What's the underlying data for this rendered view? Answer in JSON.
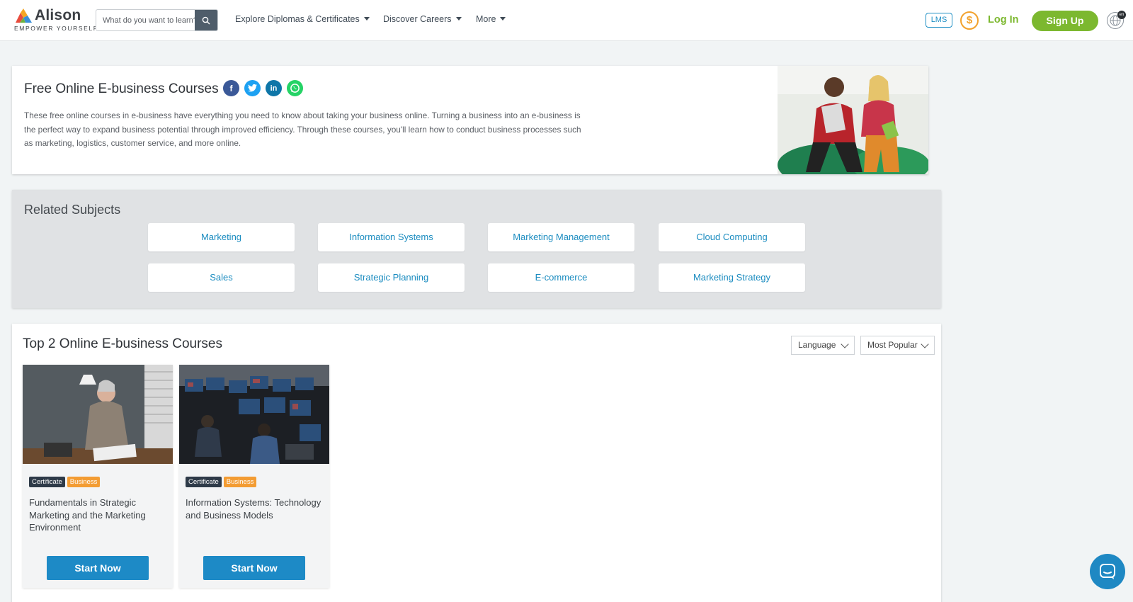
{
  "brand": {
    "name": "Alison",
    "tagline": "EMPOWER YOURSELF"
  },
  "search": {
    "placeholder": "What do you want to learn?"
  },
  "nav": {
    "diplomas": "Explore Diplomas & Certificates",
    "careers": "Discover Careers",
    "more": "More"
  },
  "header_actions": {
    "lms": "LMS",
    "dollar": "$",
    "login": "Log In",
    "signup": "Sign Up",
    "lang_badge": "en"
  },
  "hero": {
    "title": "Free Online E-business Courses",
    "description": "These free online courses in e-business have everything you need to know about taking your business online. Turning a business into an e-business is the perfect way to expand business potential through improved efficiency. Through these courses, you'll learn how to conduct business processes such as marketing, logistics, customer service, and more online.",
    "share_icons": [
      "facebook-icon",
      "twitter-icon",
      "linkedin-icon",
      "whatsapp-icon"
    ]
  },
  "related": {
    "title": "Related Subjects",
    "subjects": [
      "Marketing",
      "Information Systems",
      "Marketing Management",
      "Cloud Computing",
      "Sales",
      "Strategic Planning",
      "E-commerce",
      "Marketing Strategy"
    ]
  },
  "courses": {
    "title": "Top 2 Online E-business Courses",
    "filters": {
      "language": "Language",
      "sort": "Most Popular"
    },
    "items": [
      {
        "type": "Certificate",
        "category": "Business",
        "title": "Fundamentals in Strategic Marketing and the Marketing Environment",
        "cta": "Start Now"
      },
      {
        "type": "Certificate",
        "category": "Business",
        "title": "Information Systems: Technology and Business Models",
        "cta": "Start Now"
      }
    ]
  },
  "colors": {
    "green": "#7cb82f",
    "blue": "#1d8ac6",
    "orange": "#f39c33",
    "dark": "#2e3a48"
  }
}
